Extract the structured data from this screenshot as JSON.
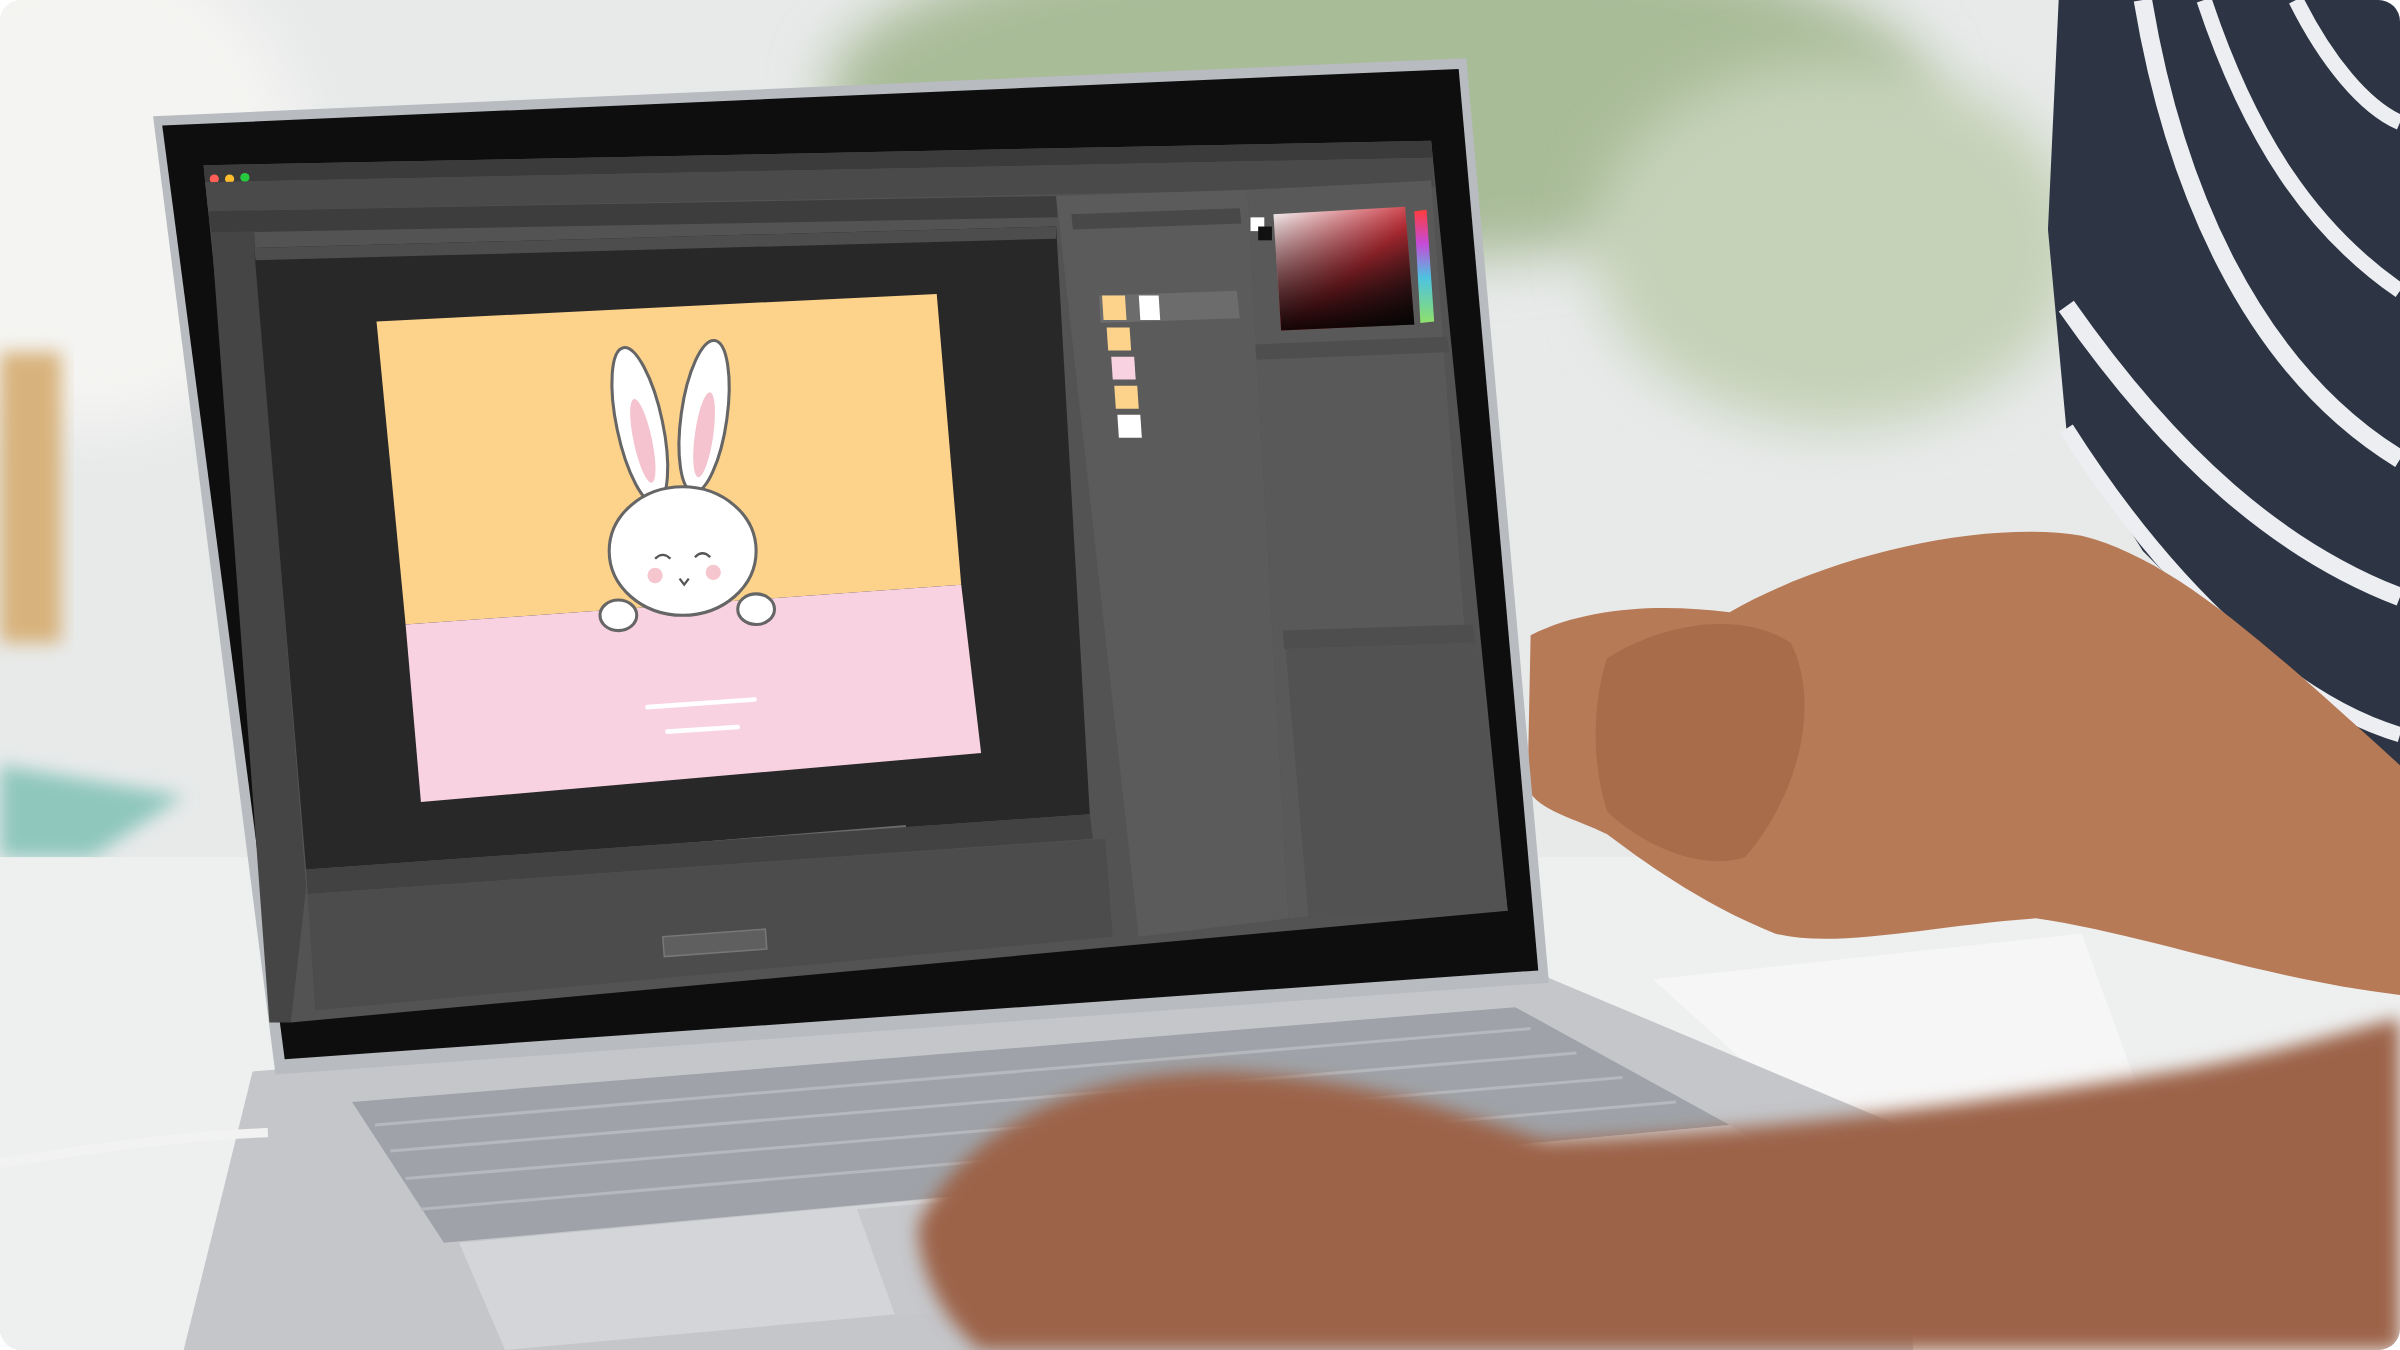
{
  "image": {
    "kind": "photo"
  }
}
